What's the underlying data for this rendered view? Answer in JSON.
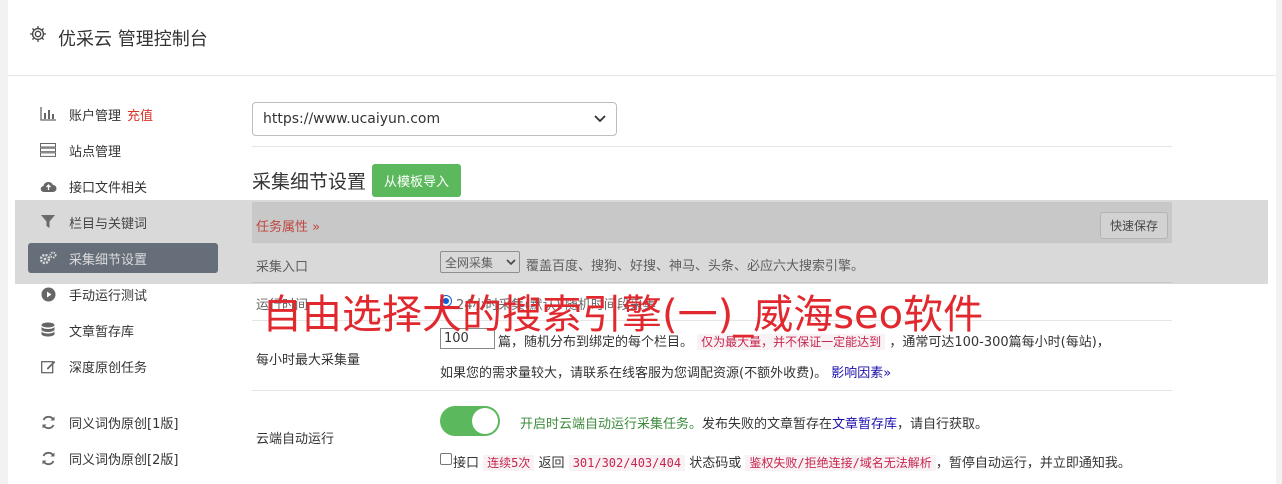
{
  "header": {
    "title": "优采云 管理控制台",
    "icon": "gear-icon"
  },
  "sidebar": {
    "items": [
      {
        "label": "账户管理",
        "extra": "充值",
        "icon": "bar-chart-icon"
      },
      {
        "label": "站点管理",
        "icon": "server-icon"
      },
      {
        "label": "接口文件相关",
        "icon": "cloud-upload-icon"
      },
      {
        "label": "栏目与关键词",
        "icon": "filter-icon"
      },
      {
        "label": "采集细节设置",
        "icon": "gears-icon",
        "active": true
      },
      {
        "label": "手动运行测试",
        "icon": "play-circle-icon"
      },
      {
        "label": "文章暂存库",
        "icon": "database-icon"
      },
      {
        "label": "深度原创任务",
        "icon": "edit-icon"
      },
      {
        "label": "同义词伪原创[1版]",
        "icon": "refresh-icon"
      },
      {
        "label": "同义词伪原创[2版]",
        "icon": "refresh-icon"
      }
    ]
  },
  "main": {
    "site_select": "https://www.ucaiyun.com",
    "section_title": "采集细节设置",
    "import_button": "从模板导入",
    "task_attr_label": "任务属性 »",
    "quick_save": "快速保存",
    "entry": {
      "label": "采集入口",
      "select": "全网采集",
      "desc": "覆盖百度、搜狗、好搜、神马、头条、必应六大搜索引擎。"
    },
    "runtime": {
      "label": "运行时间",
      "text": "24小时采集(默认)  随机时间段采集"
    },
    "max_collect": {
      "label": "每小时最大采集量",
      "value": "100",
      "line1_a": "篇，随机分布到绑定的每个栏目。",
      "line1_code": "仅为最大量，并不保证一定能达到",
      "line1_b": "，通常可达100-300篇每小时(每站)，",
      "line2_a": "如果您的需求量较大，请联系在线客服为您调配资源(不额外收费)。",
      "line2_link": "影响因素»"
    },
    "cloud": {
      "label": "云端自动运行",
      "line1_green": "开启时云端自动运行采集任务。",
      "line1_a": "发布失败的文章暂存在",
      "line1_link": "文章暂存库",
      "line1_b": "，请自行获取。",
      "line2_a": "接口",
      "line2_code1": "连续5次",
      "line2_b": "返回",
      "line2_code2": "301/302/403/404",
      "line2_c": "状态码或",
      "line2_code3": "鉴权失败/拒绝连接/域名无法解析",
      "line2_d": "，暂停自动运行，并立即通知我。"
    }
  },
  "watermark": "自由选择大的搜索引擎(一)_威海seo软件",
  "colors": {
    "accent_green": "#5cb85c",
    "danger_red": "#d9342b",
    "active_bg": "#5f6b7a"
  }
}
